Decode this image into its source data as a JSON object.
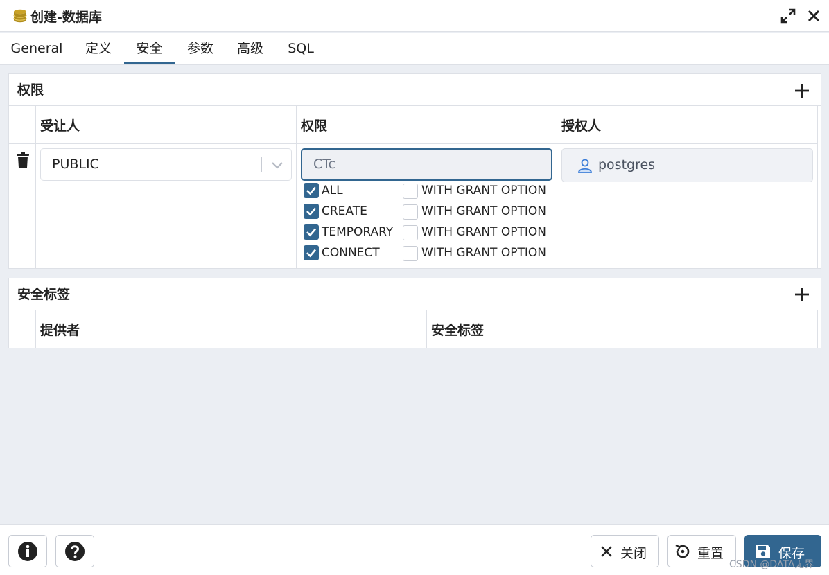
{
  "window": {
    "title": "创建-数据库",
    "title_icon": "database-icon"
  },
  "tabs": [
    {
      "label": "General"
    },
    {
      "label": "定义"
    },
    {
      "label": "安全"
    },
    {
      "label": "参数"
    },
    {
      "label": "高级"
    },
    {
      "label": "SQL"
    }
  ],
  "active_tab": "安全",
  "privileges": {
    "title": "权限",
    "columns": [
      "受让人",
      "权限",
      "授权人"
    ],
    "row": {
      "grantee": "PUBLIC",
      "privilege_summary": "CTc",
      "grantor": "postgres",
      "options": [
        {
          "label": "ALL",
          "checked": true,
          "grant_label": "WITH GRANT OPTION",
          "grant_checked": false
        },
        {
          "label": "CREATE",
          "checked": true,
          "grant_label": "WITH GRANT OPTION",
          "grant_checked": false
        },
        {
          "label": "TEMPORARY",
          "checked": true,
          "grant_label": "WITH GRANT OPTION",
          "grant_checked": false
        },
        {
          "label": "CONNECT",
          "checked": true,
          "grant_label": "WITH GRANT OPTION",
          "grant_checked": false
        }
      ]
    }
  },
  "security_labels": {
    "title": "安全标签",
    "columns": [
      "提供者",
      "安全标签"
    ]
  },
  "footer": {
    "close_label": "关闭",
    "reset_label": "重置",
    "save_label": "保存"
  },
  "watermark": "CSDN @DATA无界",
  "colors": {
    "accent": "#326690",
    "db_icon": "#c9a227"
  }
}
